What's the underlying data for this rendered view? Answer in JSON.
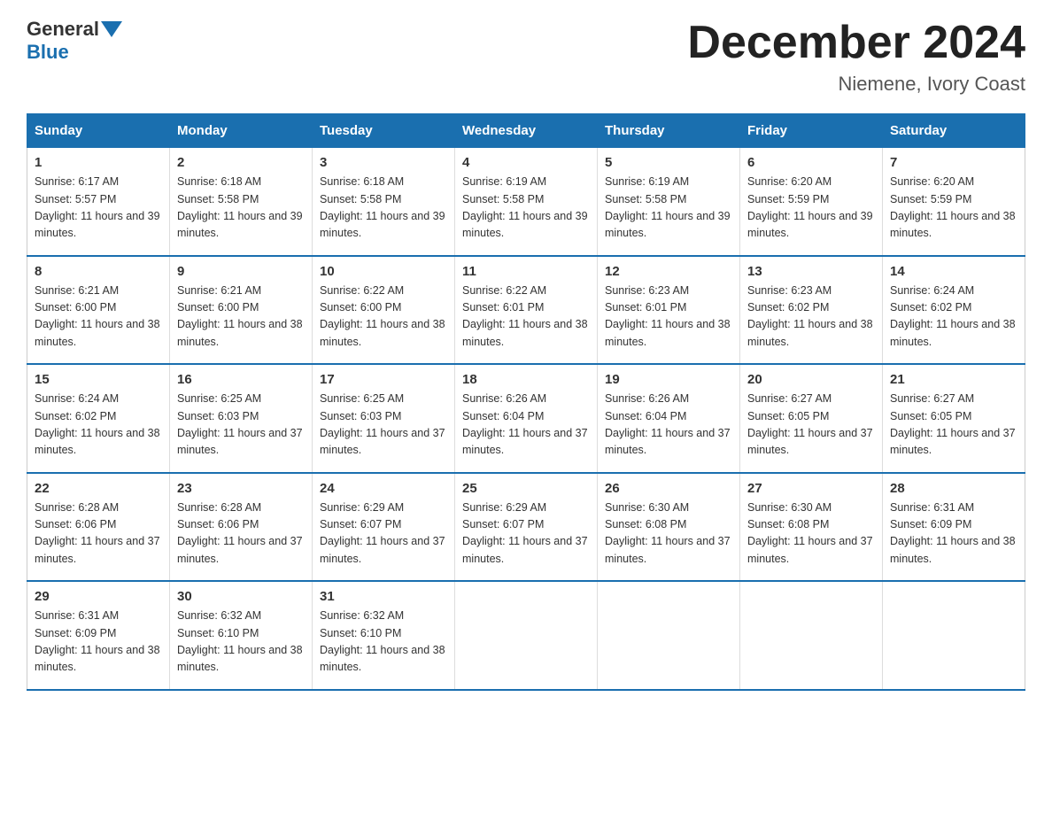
{
  "header": {
    "logo_text_general": "General",
    "logo_text_blue": "Blue",
    "month_title": "December 2024",
    "location": "Niemene, Ivory Coast"
  },
  "days_of_week": [
    "Sunday",
    "Monday",
    "Tuesday",
    "Wednesday",
    "Thursday",
    "Friday",
    "Saturday"
  ],
  "weeks": [
    [
      {
        "day": "1",
        "sunrise": "6:17 AM",
        "sunset": "5:57 PM",
        "daylight": "11 hours and 39 minutes."
      },
      {
        "day": "2",
        "sunrise": "6:18 AM",
        "sunset": "5:58 PM",
        "daylight": "11 hours and 39 minutes."
      },
      {
        "day": "3",
        "sunrise": "6:18 AM",
        "sunset": "5:58 PM",
        "daylight": "11 hours and 39 minutes."
      },
      {
        "day": "4",
        "sunrise": "6:19 AM",
        "sunset": "5:58 PM",
        "daylight": "11 hours and 39 minutes."
      },
      {
        "day": "5",
        "sunrise": "6:19 AM",
        "sunset": "5:58 PM",
        "daylight": "11 hours and 39 minutes."
      },
      {
        "day": "6",
        "sunrise": "6:20 AM",
        "sunset": "5:59 PM",
        "daylight": "11 hours and 39 minutes."
      },
      {
        "day": "7",
        "sunrise": "6:20 AM",
        "sunset": "5:59 PM",
        "daylight": "11 hours and 38 minutes."
      }
    ],
    [
      {
        "day": "8",
        "sunrise": "6:21 AM",
        "sunset": "6:00 PM",
        "daylight": "11 hours and 38 minutes."
      },
      {
        "day": "9",
        "sunrise": "6:21 AM",
        "sunset": "6:00 PM",
        "daylight": "11 hours and 38 minutes."
      },
      {
        "day": "10",
        "sunrise": "6:22 AM",
        "sunset": "6:00 PM",
        "daylight": "11 hours and 38 minutes."
      },
      {
        "day": "11",
        "sunrise": "6:22 AM",
        "sunset": "6:01 PM",
        "daylight": "11 hours and 38 minutes."
      },
      {
        "day": "12",
        "sunrise": "6:23 AM",
        "sunset": "6:01 PM",
        "daylight": "11 hours and 38 minutes."
      },
      {
        "day": "13",
        "sunrise": "6:23 AM",
        "sunset": "6:02 PM",
        "daylight": "11 hours and 38 minutes."
      },
      {
        "day": "14",
        "sunrise": "6:24 AM",
        "sunset": "6:02 PM",
        "daylight": "11 hours and 38 minutes."
      }
    ],
    [
      {
        "day": "15",
        "sunrise": "6:24 AM",
        "sunset": "6:02 PM",
        "daylight": "11 hours and 38 minutes."
      },
      {
        "day": "16",
        "sunrise": "6:25 AM",
        "sunset": "6:03 PM",
        "daylight": "11 hours and 37 minutes."
      },
      {
        "day": "17",
        "sunrise": "6:25 AM",
        "sunset": "6:03 PM",
        "daylight": "11 hours and 37 minutes."
      },
      {
        "day": "18",
        "sunrise": "6:26 AM",
        "sunset": "6:04 PM",
        "daylight": "11 hours and 37 minutes."
      },
      {
        "day": "19",
        "sunrise": "6:26 AM",
        "sunset": "6:04 PM",
        "daylight": "11 hours and 37 minutes."
      },
      {
        "day": "20",
        "sunrise": "6:27 AM",
        "sunset": "6:05 PM",
        "daylight": "11 hours and 37 minutes."
      },
      {
        "day": "21",
        "sunrise": "6:27 AM",
        "sunset": "6:05 PM",
        "daylight": "11 hours and 37 minutes."
      }
    ],
    [
      {
        "day": "22",
        "sunrise": "6:28 AM",
        "sunset": "6:06 PM",
        "daylight": "11 hours and 37 minutes."
      },
      {
        "day": "23",
        "sunrise": "6:28 AM",
        "sunset": "6:06 PM",
        "daylight": "11 hours and 37 minutes."
      },
      {
        "day": "24",
        "sunrise": "6:29 AM",
        "sunset": "6:07 PM",
        "daylight": "11 hours and 37 minutes."
      },
      {
        "day": "25",
        "sunrise": "6:29 AM",
        "sunset": "6:07 PM",
        "daylight": "11 hours and 37 minutes."
      },
      {
        "day": "26",
        "sunrise": "6:30 AM",
        "sunset": "6:08 PM",
        "daylight": "11 hours and 37 minutes."
      },
      {
        "day": "27",
        "sunrise": "6:30 AM",
        "sunset": "6:08 PM",
        "daylight": "11 hours and 37 minutes."
      },
      {
        "day": "28",
        "sunrise": "6:31 AM",
        "sunset": "6:09 PM",
        "daylight": "11 hours and 38 minutes."
      }
    ],
    [
      {
        "day": "29",
        "sunrise": "6:31 AM",
        "sunset": "6:09 PM",
        "daylight": "11 hours and 38 minutes."
      },
      {
        "day": "30",
        "sunrise": "6:32 AM",
        "sunset": "6:10 PM",
        "daylight": "11 hours and 38 minutes."
      },
      {
        "day": "31",
        "sunrise": "6:32 AM",
        "sunset": "6:10 PM",
        "daylight": "11 hours and 38 minutes."
      },
      {
        "day": "",
        "sunrise": "",
        "sunset": "",
        "daylight": ""
      },
      {
        "day": "",
        "sunrise": "",
        "sunset": "",
        "daylight": ""
      },
      {
        "day": "",
        "sunrise": "",
        "sunset": "",
        "daylight": ""
      },
      {
        "day": "",
        "sunrise": "",
        "sunset": "",
        "daylight": ""
      }
    ]
  ]
}
